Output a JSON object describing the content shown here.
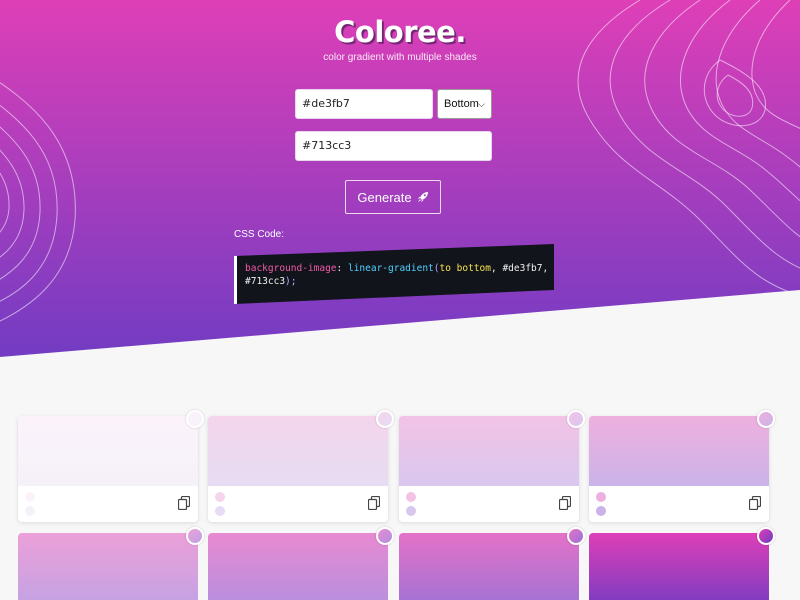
{
  "header": {
    "title": "Coloree.",
    "subtitle": "color gradient with multiple shades"
  },
  "form": {
    "color1": "#de3fb7",
    "color2": "#713cc3",
    "direction": "Bottom",
    "generate_label": "Generate"
  },
  "code": {
    "label": "CSS Code:",
    "property": "background-image",
    "function": "linear-gradient",
    "direction": "to bottom",
    "stop1": "#de3fb7",
    "stop2": "#713cc3"
  },
  "colors": {
    "start": "#de3fb7",
    "end": "#713cc3"
  },
  "shades_row1": [
    {
      "top": "#fcf3fa",
      "bottom": "#f5f1f9"
    },
    {
      "top": "#f4d5ec",
      "bottom": "#e6dcf3"
    },
    {
      "top": "#f2c3e6",
      "bottom": "#d9c7ee"
    },
    {
      "top": "#eeb0de",
      "bottom": "#cbb3e9"
    }
  ],
  "shades_row2": [
    {
      "top": "#eca0d8",
      "bottom": "#bea2e4"
    },
    {
      "top": "#e88ad1",
      "bottom": "#b28fe0"
    },
    {
      "top": "#e472c8",
      "bottom": "#9a72d6"
    },
    {
      "top": "#de3fb7",
      "bottom": "#713cc3"
    }
  ]
}
